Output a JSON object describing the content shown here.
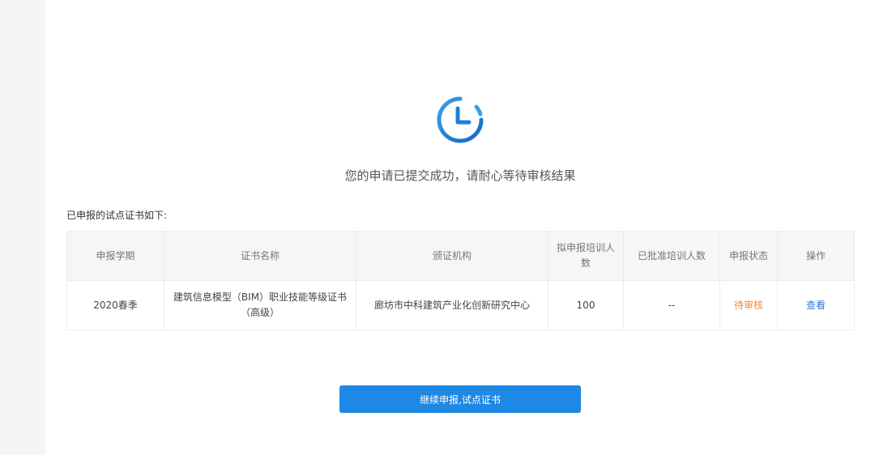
{
  "status_icon": "clock-icon",
  "colors": {
    "accent": "#1e88e5",
    "pending": "#f0883a",
    "link": "#2f7ad8"
  },
  "message": "您的申请已提交成功，请耐心等待审核结果",
  "section_label": "已申报的试点证书如下:",
  "table": {
    "headers": [
      "申报学期",
      "证书名称",
      "颁证机构",
      "拟申报培训人数",
      "已批准培训人数",
      "申报状态",
      "操作"
    ],
    "rows": [
      {
        "term": "2020春季",
        "cert_name": "建筑信息模型（BIM）职业技能等级证书（高级）",
        "issuer": "廊坊市中科建筑产业化创新研究中心",
        "planned_count": "100",
        "approved_count": "--",
        "status": "待审核",
        "action": "查看"
      }
    ]
  },
  "continue_button": "继续申报,试点证书"
}
